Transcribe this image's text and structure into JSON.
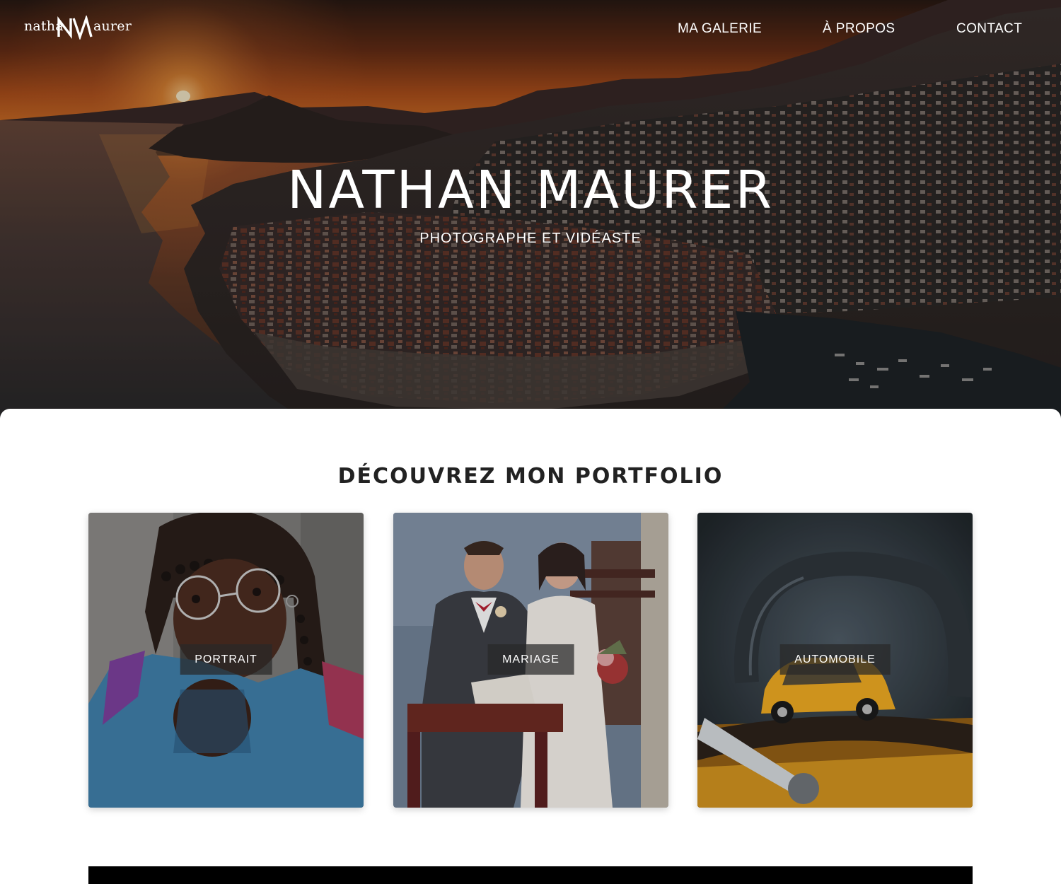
{
  "header": {
    "logo": {
      "left": "natha",
      "right": "aurer",
      "monogram": "NM"
    },
    "nav": [
      {
        "label": "MA GALERIE"
      },
      {
        "label": "À PROPOS"
      },
      {
        "label": "CONTACT"
      }
    ]
  },
  "hero": {
    "title": "NATHAN MAURER",
    "subtitle": "PHOTOGRAPHE ET VIDÉASTE",
    "image": "sunset-coastal-city-photo"
  },
  "portfolio": {
    "title": "DÉCOUVREZ MON PORTFOLIO",
    "cards": [
      {
        "label": "PORTRAIT",
        "image": "portrait-photo"
      },
      {
        "label": "MARIAGE",
        "image": "wedding-photo"
      },
      {
        "label": "AUTOMOBILE",
        "image": "toy-car-photo"
      }
    ]
  },
  "colors": {
    "accent": "#ffffff",
    "heading": "#222222",
    "label_bg": "#282828"
  }
}
